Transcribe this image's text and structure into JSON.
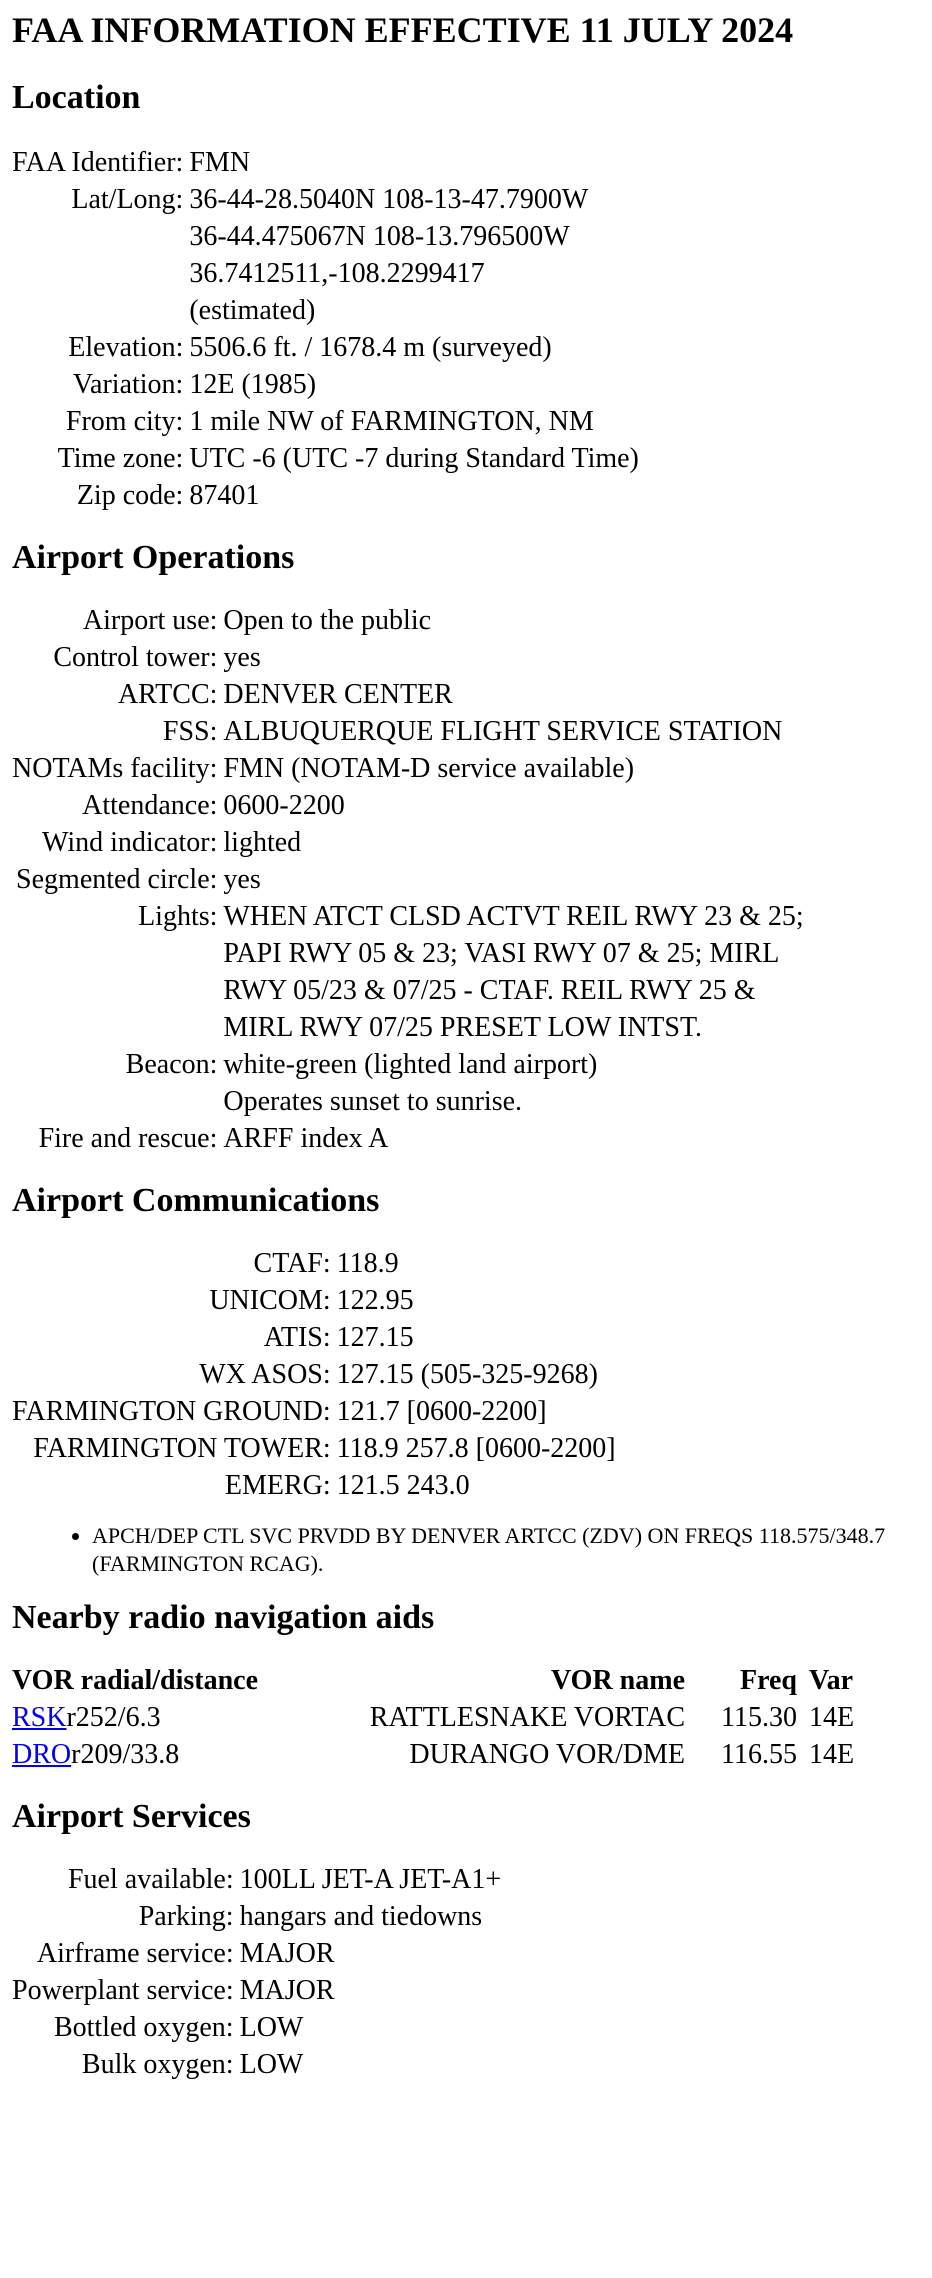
{
  "title": "FAA INFORMATION EFFECTIVE 11 JULY 2024",
  "location": {
    "heading": "Location",
    "rows": [
      {
        "k": "FAA Identifier:",
        "v": [
          "FMN"
        ]
      },
      {
        "k": "Lat/Long:",
        "v": [
          "36-44-28.5040N 108-13-47.7900W",
          "36-44.475067N 108-13.796500W",
          "36.7412511,-108.2299417",
          "(estimated)"
        ]
      },
      {
        "k": "Elevation:",
        "v": [
          "5506.6 ft. / 1678.4 m (surveyed)"
        ]
      },
      {
        "k": "Variation:",
        "v": [
          "12E (1985)"
        ]
      },
      {
        "k": "From city:",
        "v": [
          "1 mile NW of FARMINGTON, NM"
        ]
      },
      {
        "k": "Time zone:",
        "v": [
          "UTC -6 (UTC -7 during Standard Time)"
        ]
      },
      {
        "k": "Zip code:",
        "v": [
          "87401"
        ]
      }
    ]
  },
  "operations": {
    "heading": "Airport Operations",
    "rows": [
      {
        "k": "Airport use:",
        "v": [
          "Open to the public"
        ]
      },
      {
        "k": "Control tower:",
        "v": [
          "yes"
        ]
      },
      {
        "k": "ARTCC:",
        "v": [
          "DENVER CENTER"
        ]
      },
      {
        "k": "FSS:",
        "v": [
          "ALBUQUERQUE FLIGHT SERVICE STATION"
        ]
      },
      {
        "k": "NOTAMs facility:",
        "v": [
          "FMN (NOTAM-D service available)"
        ]
      },
      {
        "k": "Attendance:",
        "v": [
          "0600-2200"
        ]
      },
      {
        "k": "Wind indicator:",
        "v": [
          "lighted"
        ]
      },
      {
        "k": "Segmented circle:",
        "v": [
          "yes"
        ]
      },
      {
        "k": "Lights:",
        "v": [
          "WHEN ATCT CLSD ACTVT REIL RWY 23 & 25;",
          "PAPI RWY 05 & 23; VASI RWY 07 & 25; MIRL",
          "RWY 05/23 & 07/25 - CTAF. REIL RWY 25 &",
          "MIRL RWY 07/25 PRESET LOW INTST."
        ]
      },
      {
        "k": "Beacon:",
        "v": [
          "white-green (lighted land airport)",
          "Operates sunset to sunrise."
        ]
      },
      {
        "k": "Fire and rescue:",
        "v": [
          "ARFF index A"
        ]
      }
    ]
  },
  "communications": {
    "heading": "Airport Communications",
    "rows": [
      {
        "k": "CTAF:",
        "v": [
          "118.9"
        ]
      },
      {
        "k": "UNICOM:",
        "v": [
          "122.95"
        ]
      },
      {
        "k": "ATIS:",
        "v": [
          "127.15"
        ]
      },
      {
        "k": "WX ASOS:",
        "v": [
          "127.15 (505-325-9268)"
        ]
      },
      {
        "k": "FARMINGTON GROUND:",
        "v": [
          "121.7 [0600-2200]"
        ]
      },
      {
        "k": "FARMINGTON TOWER:",
        "v": [
          "118.9 257.8 [0600-2200]"
        ]
      },
      {
        "k": "EMERG:",
        "v": [
          "121.5 243.0"
        ]
      }
    ],
    "notes": [
      "APCH/DEP CTL SVC PRVDD BY DENVER ARTCC (ZDV) ON FREQS 118.575/348.7 (FARMINGTON RCAG)."
    ]
  },
  "navaids": {
    "heading": "Nearby radio navigation aids",
    "columns": [
      "VOR radial/distance",
      "VOR name",
      "Freq",
      "Var"
    ],
    "rows": [
      {
        "id": "RSK",
        "radial": "r252/6.3",
        "name": "RATTLESNAKE VORTAC",
        "freq": "115.30",
        "var": "14E"
      },
      {
        "id": "DRO",
        "radial": "r209/33.8",
        "name": "DURANGO VOR/DME",
        "freq": "116.55",
        "var": "14E"
      }
    ]
  },
  "services": {
    "heading": "Airport Services",
    "rows": [
      {
        "k": "Fuel available:",
        "v": [
          "100LL JET-A JET-A1+"
        ]
      },
      {
        "k": "Parking:",
        "v": [
          "hangars and tiedowns"
        ]
      },
      {
        "k": "Airframe service:",
        "v": [
          "MAJOR"
        ]
      },
      {
        "k": "Powerplant service:",
        "v": [
          "MAJOR"
        ]
      },
      {
        "k": "Bottled oxygen:",
        "v": [
          "LOW"
        ]
      },
      {
        "k": "Bulk oxygen:",
        "v": [
          "LOW"
        ]
      }
    ]
  }
}
